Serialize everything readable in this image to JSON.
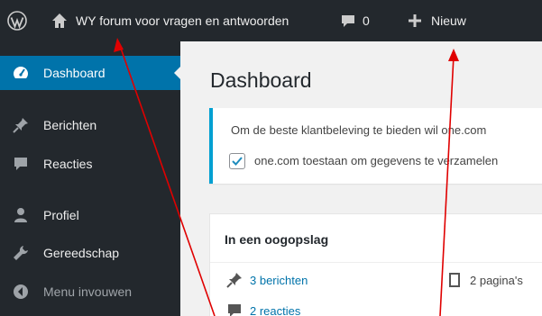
{
  "admin_bar": {
    "site_name": "WY forum voor vragen en antwoorden",
    "comments_count": "0",
    "new_label": "Nieuw"
  },
  "sidebar": {
    "items": [
      {
        "label": "Dashboard",
        "icon": "dashboard-icon"
      },
      {
        "label": "Berichten",
        "icon": "pin-icon"
      },
      {
        "label": "Reacties",
        "icon": "comment-icon"
      },
      {
        "label": "Profiel",
        "icon": "user-icon"
      },
      {
        "label": "Gereedschap",
        "icon": "wrench-icon"
      },
      {
        "label": "Menu invouwen",
        "icon": "collapse-icon"
      }
    ]
  },
  "main": {
    "title": "Dashboard",
    "notice": {
      "text": "Om de beste klantbeleving te bieden wil one.com",
      "checkbox_label": "one.com toestaan om gegevens te verzamelen",
      "checked": true
    },
    "glance": {
      "title": "In een oogopslag",
      "posts": "3 berichten",
      "pages": "2 pagina's",
      "comments": "2 reacties"
    }
  },
  "colors": {
    "admin_bar_bg": "#23282d",
    "active_menu": "#0073aa",
    "notice_border": "#00a0d2",
    "arrow": "#e00000"
  }
}
